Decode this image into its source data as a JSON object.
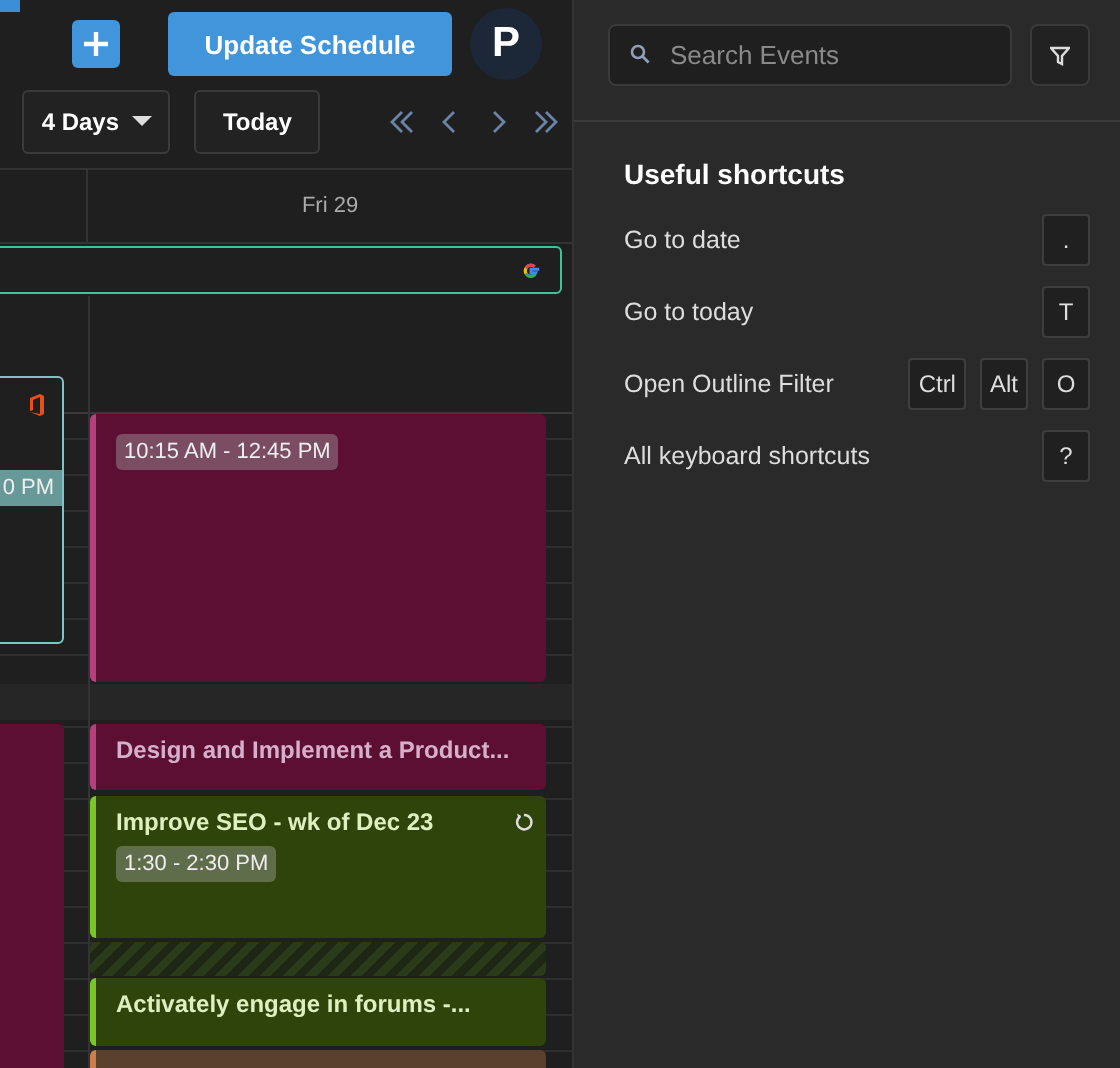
{
  "top_bar": {
    "update_button": "Update Schedule",
    "avatar_initial": "P"
  },
  "toolbar": {
    "view_dropdown": "4 Days",
    "today_button": "Today"
  },
  "day_header": "Fri 29",
  "previous_day_events": [
    {
      "kind": "outlined",
      "time": "0 PM",
      "color": "#7fc4c4"
    },
    {
      "kind": "event",
      "color": "#5c0f33"
    }
  ],
  "day_events": [
    {
      "kind": "event",
      "time": "10:15 AM - 12:45 PM",
      "color": "#5c0f33"
    },
    {
      "kind": "event",
      "title": "Design and Implement a Product...",
      "color": "#5c0f33"
    },
    {
      "kind": "event",
      "title": "Improve SEO - wk of Dec 23",
      "time": "1:30 - 2:30 PM",
      "color": "#2e440b",
      "recurring": true
    },
    {
      "kind": "blocked"
    },
    {
      "kind": "event",
      "title": "Activately engage in forums -...",
      "color": "#2e440b"
    },
    {
      "kind": "event",
      "color": "#5a3f2c"
    }
  ],
  "side_panel": {
    "search": {
      "placeholder": "Search Events"
    },
    "shortcuts_title": "Useful shortcuts",
    "shortcuts": [
      {
        "label": "Go to date",
        "keys": [
          "."
        ]
      },
      {
        "label": "Go to today",
        "keys": [
          "T"
        ]
      },
      {
        "label": "Open Outline Filter",
        "keys": [
          "Ctrl",
          "Alt",
          "O"
        ]
      },
      {
        "label": "All keyboard shortcuts",
        "keys": [
          "?"
        ]
      }
    ]
  }
}
